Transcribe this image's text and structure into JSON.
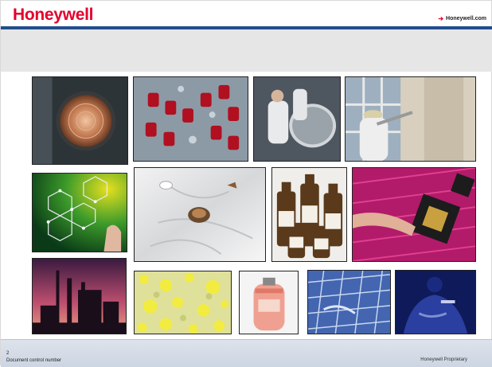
{
  "header": {
    "logo_text": "Honeywell",
    "link_text": "Honeywell.com",
    "link_icon": "arrow-right-icon"
  },
  "photos": [
    {
      "name": "copper-disc-photo"
    },
    {
      "name": "red-glass-vials-photo"
    },
    {
      "name": "lab-technicians-photo"
    },
    {
      "name": "worker-spraying-photo"
    },
    {
      "name": "molecular-structure-photo"
    },
    {
      "name": "bullet-impact-fabric-photo"
    },
    {
      "name": "chemical-bottles-photo"
    },
    {
      "name": "microchip-finger-photo"
    },
    {
      "name": "refinery-sunset-photo"
    },
    {
      "name": "yellow-granules-photo"
    },
    {
      "name": "refrigerant-cylinder-photo"
    },
    {
      "name": "solar-cells-photo"
    },
    {
      "name": "police-officer-photo"
    }
  ],
  "footer": {
    "page_number": "2",
    "document_control": "Document control number",
    "proprietary": "Honeywell Proprietary"
  },
  "colors": {
    "brand_red": "#e4002b",
    "header_blue": "#1f4e8c"
  }
}
